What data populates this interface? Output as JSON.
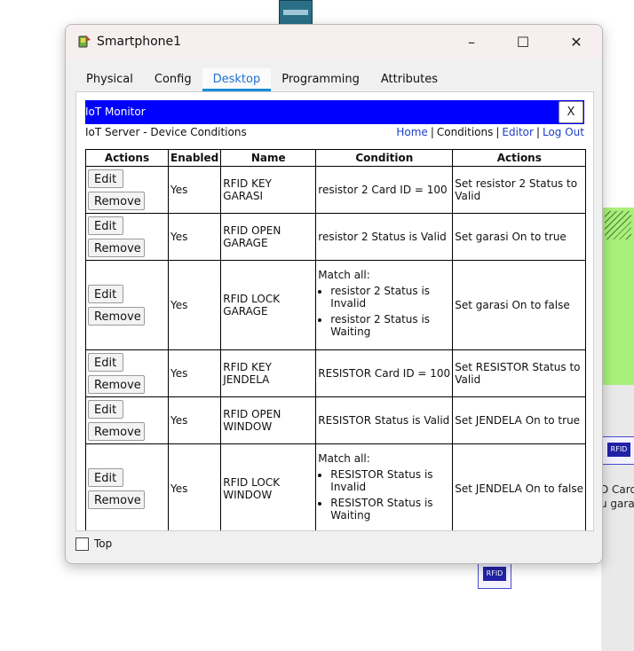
{
  "window": {
    "title": "Smartphone1"
  },
  "window_controls": {
    "minimize": "–",
    "maximize": "☐",
    "close": "✕"
  },
  "tabs": [
    {
      "label": "Physical"
    },
    {
      "label": "Config"
    },
    {
      "label": "Desktop",
      "active": true
    },
    {
      "label": "Programming"
    },
    {
      "label": "Attributes"
    }
  ],
  "app": {
    "title": "IoT Monitor",
    "close_label": "X",
    "subtitle": "IoT Server - Device Conditions",
    "nav": [
      "Home",
      "Conditions",
      "Editor",
      "Log Out"
    ]
  },
  "table": {
    "headers": [
      "Actions",
      "Enabled",
      "Name",
      "Condition",
      "Actions"
    ],
    "edit_label": "Edit",
    "remove_label": "Remove",
    "match_all_label": "Match all:",
    "rows": [
      {
        "enabled": "Yes",
        "name": "RFID KEY GARASI",
        "condition": "resistor 2 Card ID = 100",
        "action": "Set resistor 2 Status to Valid"
      },
      {
        "enabled": "Yes",
        "name": "RFID OPEN GARAGE",
        "condition": "resistor 2 Status is Valid",
        "action": "Set garasi On to true"
      },
      {
        "enabled": "Yes",
        "name": "RFID LOCK GARAGE",
        "condition_items": [
          "resistor 2 Status is Invalid",
          "resistor 2 Status is Waiting"
        ],
        "action": "Set garasi On to false"
      },
      {
        "enabled": "Yes",
        "name": "RFID KEY JENDELA",
        "condition": "RESISTOR Card ID = 100",
        "action": "Set RESISTOR Status to Valid"
      },
      {
        "enabled": "Yes",
        "name": "RFID OPEN WINDOW",
        "condition": "RESISTOR Status is Valid",
        "action": "Set JENDELA On to true"
      },
      {
        "enabled": "Yes",
        "name": "RFID LOCK WINDOW",
        "condition_items": [
          "RESISTOR Status is Invalid",
          "RESISTOR Status is Waiting"
        ],
        "action": "Set JENDELA On to false"
      }
    ]
  },
  "footer": {
    "top_checkbox_label": "Top",
    "top_checked": false
  },
  "background": {
    "rfid_badge": "RFID",
    "side_text_1": "D Card",
    "side_text_2": "u garas"
  },
  "colors": {
    "header_blue": "#0000ff",
    "link_blue": "#1c3fc4",
    "active_tab": "#1f6fd1",
    "green_device": "#a8f07a"
  }
}
